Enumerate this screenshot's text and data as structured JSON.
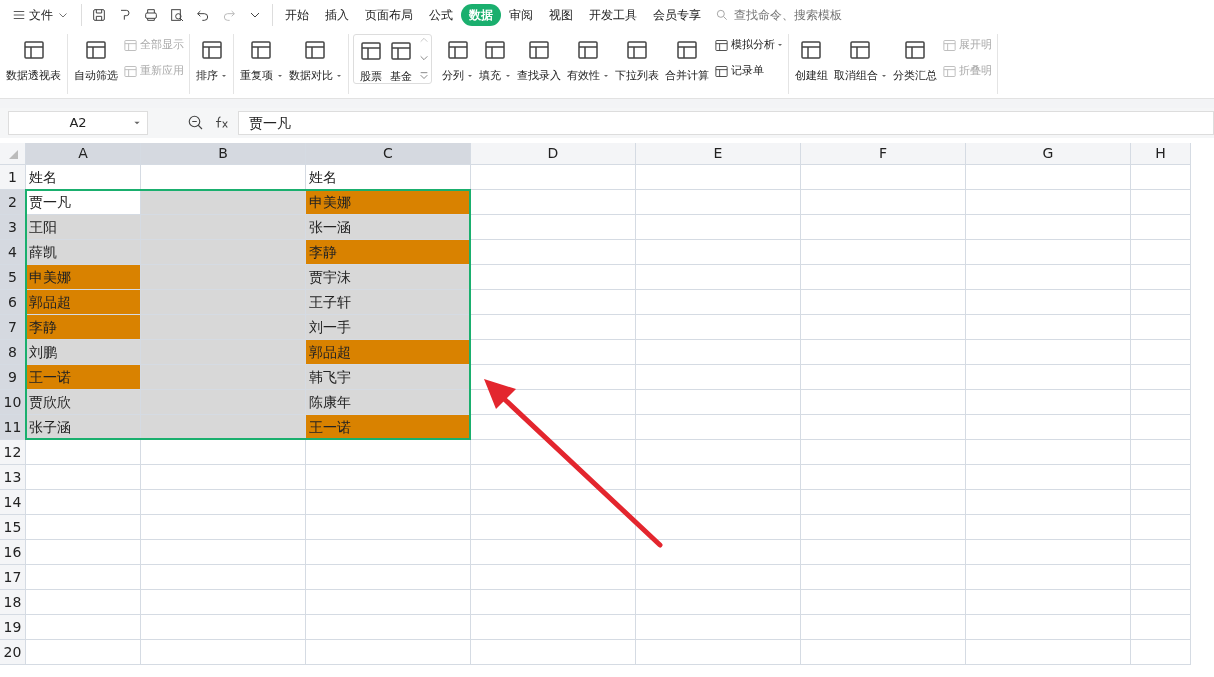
{
  "menu": {
    "label": "文件"
  },
  "tabs": [
    {
      "label": "开始",
      "selected": false
    },
    {
      "label": "插入",
      "selected": false
    },
    {
      "label": "页面布局",
      "selected": false
    },
    {
      "label": "公式",
      "selected": false
    },
    {
      "label": "数据",
      "selected": true
    },
    {
      "label": "审阅",
      "selected": false
    },
    {
      "label": "视图",
      "selected": false
    },
    {
      "label": "开发工具",
      "selected": false
    },
    {
      "label": "会员专享",
      "selected": false
    }
  ],
  "search": {
    "placeholder": "查找命令、搜索模板"
  },
  "ribbon": [
    {
      "kind": "group",
      "items": [
        {
          "kind": "large",
          "label": "数据透视表",
          "dropdown": false,
          "disabled": false
        }
      ]
    },
    {
      "kind": "group",
      "items": [
        {
          "kind": "large",
          "label": "自动筛选",
          "dropdown": false,
          "disabled": false
        },
        {
          "kind": "small",
          "label": "全部显示",
          "dropdown": false,
          "disabled": true
        },
        {
          "kind": "small",
          "label": "重新应用",
          "dropdown": false,
          "disabled": true
        }
      ]
    },
    {
      "kind": "group",
      "items": [
        {
          "kind": "large",
          "label": "排序",
          "dropdown": true,
          "disabled": false
        }
      ]
    },
    {
      "kind": "group",
      "items": [
        {
          "kind": "large",
          "label": "重复项",
          "dropdown": true,
          "disabled": false
        },
        {
          "kind": "large",
          "label": "数据对比",
          "dropdown": true,
          "disabled": false
        }
      ]
    },
    {
      "kind": "gallery",
      "items": [
        {
          "kind": "large",
          "label": "股票",
          "dropdown": false,
          "disabled": false
        },
        {
          "kind": "large",
          "label": "基金",
          "dropdown": false,
          "disabled": false
        }
      ]
    },
    {
      "kind": "group",
      "items": [
        {
          "kind": "large",
          "label": "分列",
          "dropdown": true,
          "disabled": false
        },
        {
          "kind": "large",
          "label": "填充",
          "dropdown": true,
          "disabled": false
        },
        {
          "kind": "large",
          "label": "查找录入",
          "dropdown": false,
          "disabled": false
        },
        {
          "kind": "large",
          "label": "有效性",
          "dropdown": true,
          "disabled": false
        },
        {
          "kind": "large",
          "label": "下拉列表",
          "dropdown": false,
          "disabled": false
        },
        {
          "kind": "large",
          "label": "合并计算",
          "dropdown": false,
          "disabled": false
        },
        {
          "kind": "small",
          "label": "模拟分析",
          "dropdown": true,
          "disabled": false
        },
        {
          "kind": "small",
          "label": "记录单",
          "dropdown": false,
          "disabled": false
        }
      ]
    },
    {
      "kind": "group",
      "items": [
        {
          "kind": "large",
          "label": "创建组",
          "dropdown": false,
          "disabled": false
        },
        {
          "kind": "large",
          "label": "取消组合",
          "dropdown": true,
          "disabled": false
        },
        {
          "kind": "large",
          "label": "分类汇总",
          "dropdown": false,
          "disabled": false
        },
        {
          "kind": "small",
          "label": "展开明",
          "dropdown": false,
          "disabled": true
        },
        {
          "kind": "small",
          "label": "折叠明",
          "dropdown": false,
          "disabled": true
        }
      ]
    }
  ],
  "formula_bar": {
    "name_box": "A2",
    "value": "贾一凡"
  },
  "columns": [
    {
      "label": "A",
      "selected": true
    },
    {
      "label": "B",
      "selected": true
    },
    {
      "label": "C",
      "selected": true
    },
    {
      "label": "D",
      "selected": false
    },
    {
      "label": "E",
      "selected": false
    },
    {
      "label": "F",
      "selected": false
    },
    {
      "label": "G",
      "selected": false
    },
    {
      "label": "H",
      "selected": false
    }
  ],
  "row_headers": [
    {
      "label": "1",
      "selected": false
    },
    {
      "label": "2",
      "selected": true
    },
    {
      "label": "3",
      "selected": true
    },
    {
      "label": "4",
      "selected": true
    },
    {
      "label": "5",
      "selected": true
    },
    {
      "label": "6",
      "selected": true
    },
    {
      "label": "7",
      "selected": true
    },
    {
      "label": "8",
      "selected": true
    },
    {
      "label": "9",
      "selected": true
    },
    {
      "label": "10",
      "selected": true
    },
    {
      "label": "11",
      "selected": true
    },
    {
      "label": "12",
      "selected": false
    },
    {
      "label": "13",
      "selected": false
    },
    {
      "label": "14",
      "selected": false
    },
    {
      "label": "15",
      "selected": false
    },
    {
      "label": "16",
      "selected": false
    },
    {
      "label": "17",
      "selected": false
    },
    {
      "label": "18",
      "selected": false
    },
    {
      "label": "19",
      "selected": false
    },
    {
      "label": "20",
      "selected": false
    }
  ],
  "rows": [
    [
      {
        "text": "姓名",
        "kind": "plain"
      },
      {
        "kind": "plain"
      },
      {
        "text": "姓名",
        "kind": "plain"
      }
    ],
    [
      {
        "text": "贾一凡",
        "kind": "plain"
      },
      {
        "kind": "selected"
      },
      {
        "text": "申美娜",
        "kind": "highlighted"
      }
    ],
    [
      {
        "text": "王阳",
        "kind": "selected"
      },
      {
        "kind": "selected"
      },
      {
        "text": "张一涵",
        "kind": "selected"
      }
    ],
    [
      {
        "text": "薛凯",
        "kind": "selected"
      },
      {
        "kind": "selected"
      },
      {
        "text": "李静",
        "kind": "highlighted"
      }
    ],
    [
      {
        "text": "申美娜",
        "kind": "highlighted"
      },
      {
        "kind": "selected"
      },
      {
        "text": "贾宇沫",
        "kind": "selected"
      }
    ],
    [
      {
        "text": "郭品超",
        "kind": "highlighted"
      },
      {
        "kind": "selected"
      },
      {
        "text": "王子轩",
        "kind": "selected"
      }
    ],
    [
      {
        "text": "李静",
        "kind": "highlighted"
      },
      {
        "kind": "selected"
      },
      {
        "text": "刘一手",
        "kind": "selected"
      }
    ],
    [
      {
        "text": "刘鹏",
        "kind": "selected"
      },
      {
        "kind": "selected"
      },
      {
        "text": "郭品超",
        "kind": "highlighted"
      }
    ],
    [
      {
        "text": "王一诺",
        "kind": "highlighted"
      },
      {
        "kind": "selected"
      },
      {
        "text": "韩飞宇",
        "kind": "selected"
      }
    ],
    [
      {
        "text": "贾欣欣",
        "kind": "selected"
      },
      {
        "kind": "selected"
      },
      {
        "text": "陈康年",
        "kind": "selected"
      }
    ],
    [
      {
        "text": "张子涵",
        "kind": "selected"
      },
      {
        "kind": "selected"
      },
      {
        "text": "王一诺",
        "kind": "highlighted"
      }
    ]
  ]
}
